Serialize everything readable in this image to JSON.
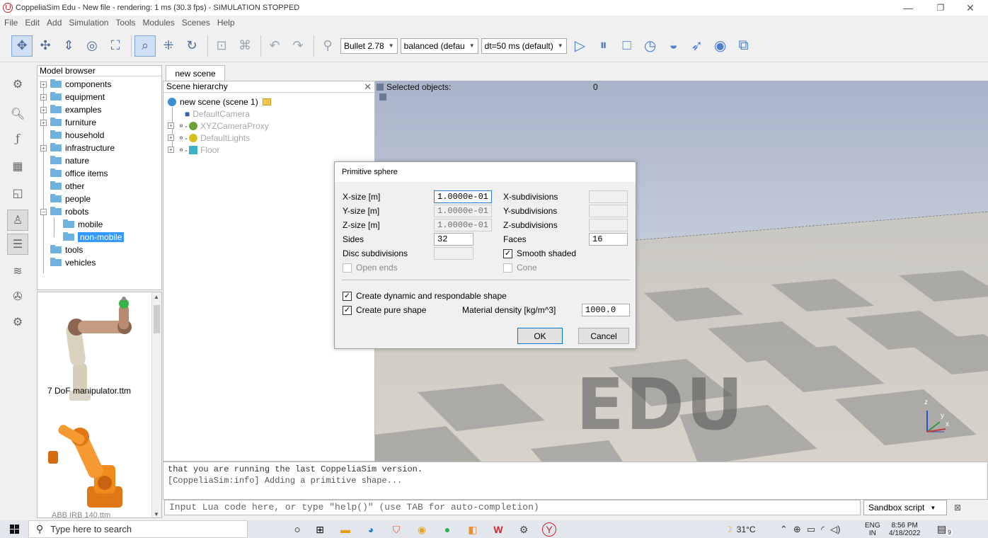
{
  "window": {
    "title": "CoppeliaSim Edu - New file - rendering: 1 ms (30.3 fps) - SIMULATION STOPPED",
    "minimize": "—",
    "maximize": "❐",
    "close": "✕"
  },
  "menu": [
    "File",
    "Edit",
    "Add",
    "Simulation",
    "Tools",
    "Modules",
    "Scenes",
    "Help"
  ],
  "toolbar": {
    "engine": "Bullet 2.78",
    "preset": "balanced (defau",
    "dt": "dt=50 ms (default)"
  },
  "model_browser": {
    "title": "Model browser",
    "items": [
      {
        "label": "components"
      },
      {
        "label": "equipment"
      },
      {
        "label": "examples"
      },
      {
        "label": "furniture"
      },
      {
        "label": "household"
      },
      {
        "label": "infrastructure"
      },
      {
        "label": "nature"
      },
      {
        "label": "office items"
      },
      {
        "label": "other"
      },
      {
        "label": "people"
      },
      {
        "label": "robots"
      },
      {
        "label": "mobile"
      },
      {
        "label": "non-mobile"
      },
      {
        "label": "tools"
      },
      {
        "label": "vehicles"
      }
    ],
    "thumbnails": [
      {
        "label": "7 DoF manipulator.ttm"
      },
      {
        "label": "ABB IRB 140.ttm"
      }
    ]
  },
  "scene": {
    "tab": "new scene",
    "hierarchy_title": "Scene hierarchy",
    "root": "new scene (scene 1)",
    "objects": [
      "DefaultCamera",
      "XYZCameraProxy",
      "DefaultLights",
      "Floor"
    ]
  },
  "viewport": {
    "selected_label": "Selected objects:",
    "selected_count": "0",
    "watermark": "EDU",
    "axis_z": "z",
    "axis_y": "y",
    "axis_x": "x"
  },
  "dialog": {
    "title": "Primitive sphere",
    "x_size_label": "X-size [m]",
    "x_size": "1.0000e-01",
    "y_size_label": "Y-size [m]",
    "y_size": "1.0000e-01",
    "z_size_label": "Z-size [m]",
    "z_size": "1.0000e-01",
    "sides_label": "Sides",
    "sides": "32",
    "disc_label": "Disc subdivisions",
    "open_ends_label": "Open ends",
    "x_sub_label": "X-subdivisions",
    "y_sub_label": "Y-subdivisions",
    "z_sub_label": "Z-subdivisions",
    "faces_label": "Faces",
    "faces": "16",
    "smooth_label": "Smooth shaded",
    "cone_label": "Cone",
    "dynamic_label": "Create dynamic and respondable shape",
    "pure_label": "Create pure shape",
    "density_label": "Material density [kg/m^3]",
    "density": "1000.0",
    "ok": "OK",
    "cancel": "Cancel",
    "check_mark": "✓"
  },
  "console": {
    "line1": "that you are running the last CoppeliaSim version.",
    "line2": "[CoppeliaSim:info] Adding a primitive shape...",
    "input_placeholder": "Input Lua code here, or type \"help()\" (use TAB for auto-completion)",
    "script_mode": "Sandbox script"
  },
  "taskbar": {
    "search": "Type here to search",
    "weather": "31°C",
    "lang1": "ENG",
    "lang2": "IN",
    "time": "8:56 PM",
    "date": "4/18/2022",
    "notif_count": "9"
  },
  "colors": {
    "accent": "#3399ff",
    "folder": "#6fb2e0",
    "toolbar_icon": "#4f6d9a",
    "robot_orange": "#f08a1c"
  }
}
